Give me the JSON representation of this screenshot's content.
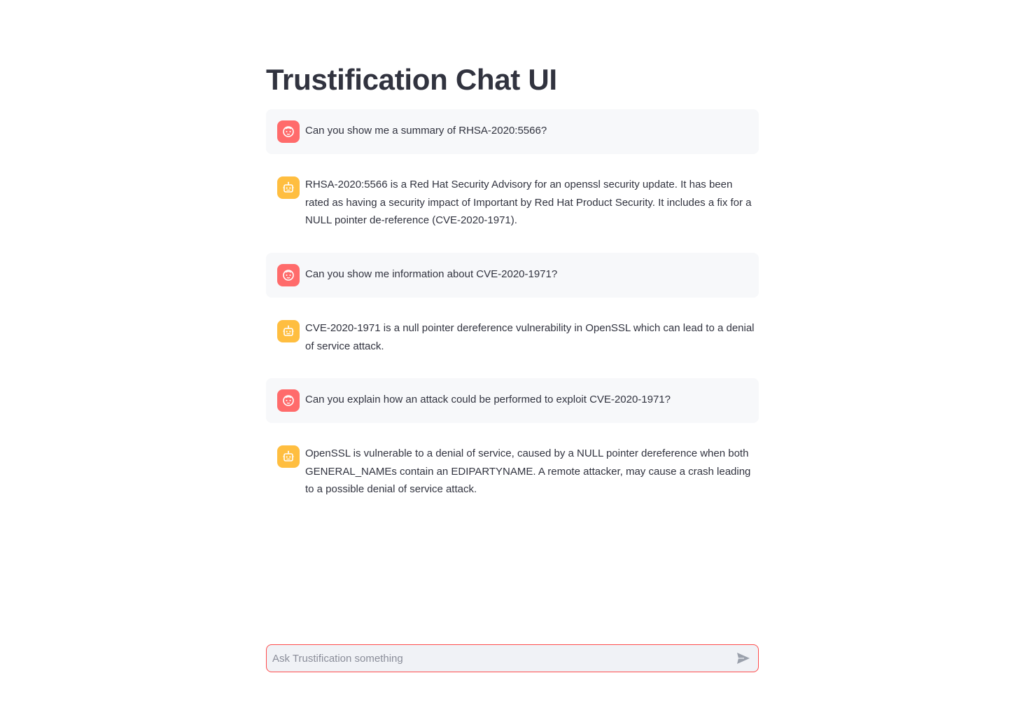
{
  "page": {
    "title": "Trustification Chat UI"
  },
  "messages": [
    {
      "role": "user",
      "avatar_icon": "user-face-icon",
      "text": "Can you show me a summary of RHSA-2020:5566?"
    },
    {
      "role": "assistant",
      "avatar_icon": "robot-icon",
      "text": "RHSA-2020:5566 is a Red Hat Security Advisory for an openssl security update. It has been rated as having a security impact of Important by Red Hat Product Security. It includes a fix for a NULL pointer de-reference (CVE-2020-1971)."
    },
    {
      "role": "user",
      "avatar_icon": "user-face-icon",
      "text": "Can you show me information about CVE-2020-1971?"
    },
    {
      "role": "assistant",
      "avatar_icon": "robot-icon",
      "text": "CVE-2020-1971 is a null pointer dereference vulnerability in OpenSSL which can lead to a denial of service attack."
    },
    {
      "role": "user",
      "avatar_icon": "user-face-icon",
      "text": "Can you explain how an attack could be performed to exploit CVE-2020-1971?"
    },
    {
      "role": "assistant",
      "avatar_icon": "robot-icon",
      "text": "OpenSSL is vulnerable to a denial of service, caused by a NULL pointer dereference when both GENERAL_NAMEs contain an EDIPARTYNAME. A remote attacker, may cause a crash leading to a possible denial of service attack."
    }
  ],
  "chat_input": {
    "placeholder": "Ask Trustification something",
    "value": "",
    "send_icon": "send-icon"
  },
  "colors": {
    "user_avatar": "#ff6b6b",
    "assistant_avatar": "#ffbe40",
    "user_message_bg": "#f7f8fa",
    "input_border": "#ff4b4b",
    "input_bg": "#f0f2f6"
  }
}
